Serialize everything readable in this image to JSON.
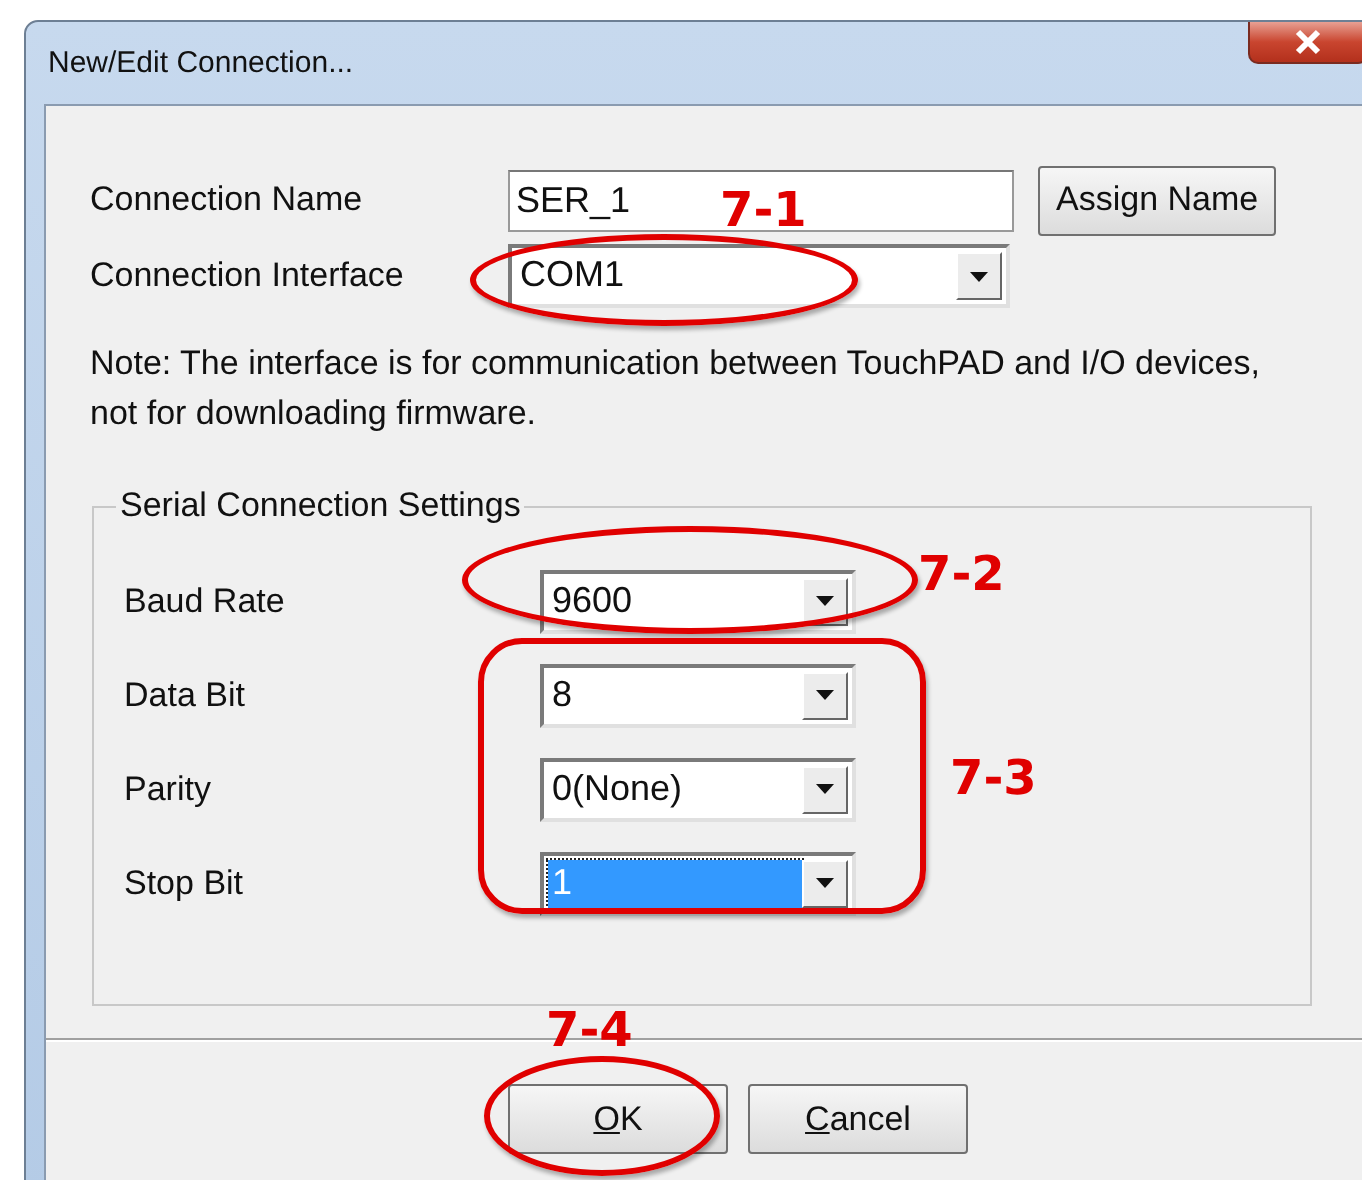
{
  "window": {
    "title": "New/Edit Connection..."
  },
  "connection": {
    "name_label": "Connection Name",
    "name_value": "SER_1",
    "assign_button": "Assign Name",
    "interface_label": "Connection Interface",
    "interface_value": "COM1",
    "note": "Note: The interface is for communication between TouchPAD and I/O devices, not for downloading firmware."
  },
  "serial": {
    "title": "Serial Connection Settings",
    "rows": [
      {
        "label": "Baud Rate",
        "value": "9600",
        "selected": false
      },
      {
        "label": "Data Bit",
        "value": "8",
        "selected": false
      },
      {
        "label": "Parity",
        "value": "0(None)",
        "selected": false
      },
      {
        "label": "Stop Bit",
        "value": "1",
        "selected": true
      }
    ]
  },
  "buttons": [
    {
      "label": "OK",
      "underline_first": true
    },
    {
      "label": "Cancel",
      "underline_first": true
    }
  ],
  "annotations": [
    {
      "kind": "ellipse",
      "label": "7-1"
    },
    {
      "kind": "ellipse",
      "label": "7-2"
    },
    {
      "kind": "rounded",
      "label": "7-3"
    },
    {
      "kind": "ellipse",
      "label": "7-4"
    }
  ]
}
